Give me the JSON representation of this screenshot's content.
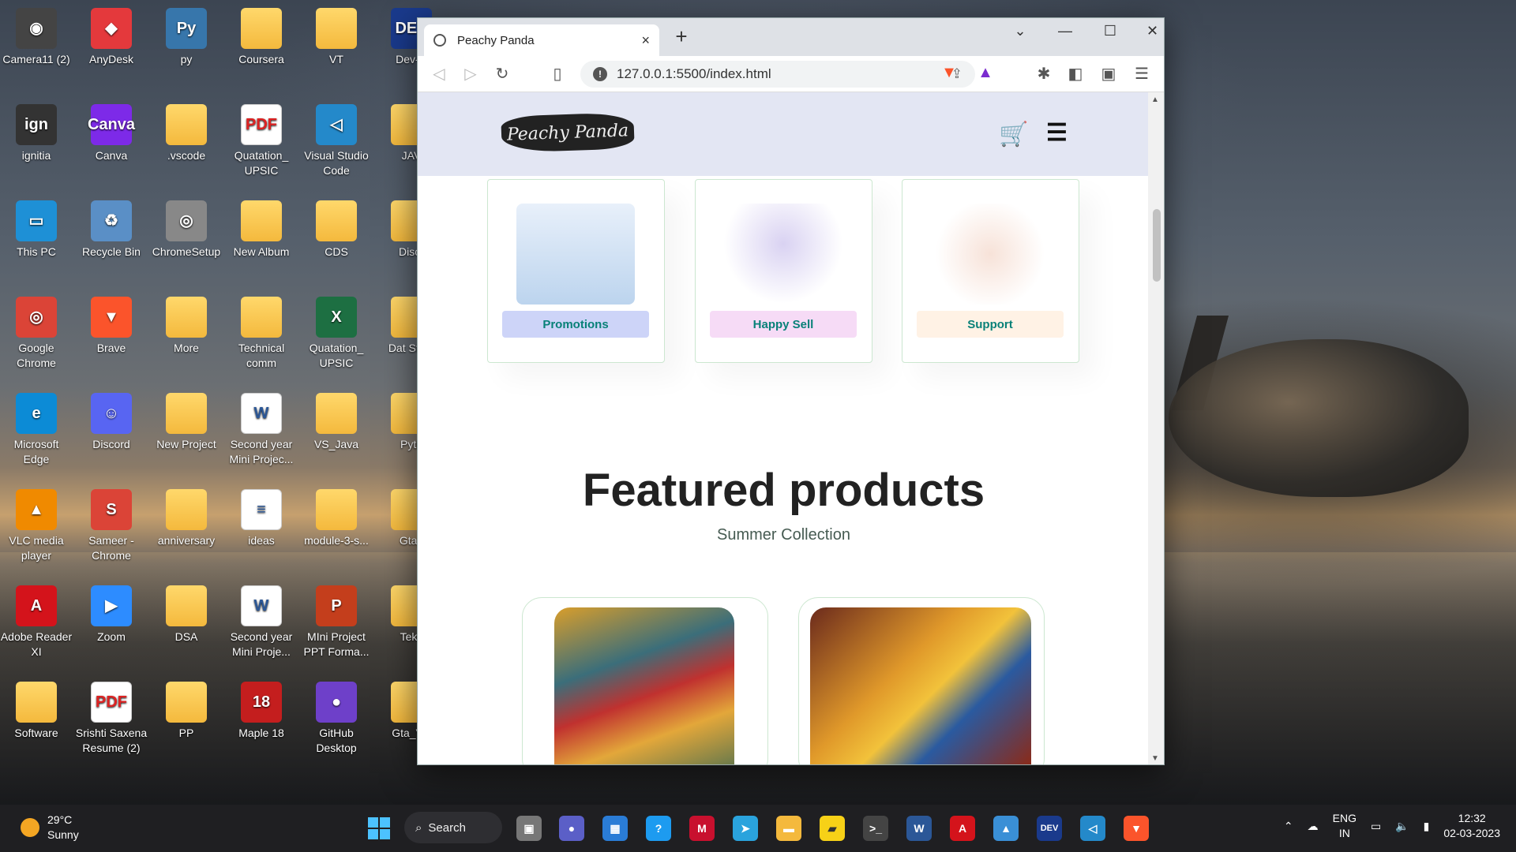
{
  "desktop_icons": [
    {
      "label": "Camera11 (2)",
      "glyph": "◉",
      "color": "#444"
    },
    {
      "label": "AnyDesk",
      "glyph": "◆",
      "color": "#e4393c"
    },
    {
      "label": "py",
      "glyph": "Py",
      "color": "#3776ab"
    },
    {
      "label": "Coursera",
      "glyph": "",
      "color": "folder"
    },
    {
      "label": "VT",
      "glyph": "",
      "color": "folder"
    },
    {
      "label": "Dev-C",
      "glyph": "DEV",
      "color": "#1a3a8c"
    },
    {
      "label": "ignitia",
      "glyph": "ign",
      "color": "#333"
    },
    {
      "label": "Canva",
      "glyph": "Canva",
      "color": "#7d2ae8"
    },
    {
      "label": ".vscode",
      "glyph": "",
      "color": "folder"
    },
    {
      "label": "Quatation_ UPSIC",
      "glyph": "PDF",
      "color": "pdf"
    },
    {
      "label": "Visual Studio Code",
      "glyph": "◁",
      "color": "#2489ca"
    },
    {
      "label": "JAV",
      "glyph": "",
      "color": "folder"
    },
    {
      "label": "This PC",
      "glyph": "▭",
      "color": "#1e90d6"
    },
    {
      "label": "Recycle Bin",
      "glyph": "♻",
      "color": "#5a8fc6"
    },
    {
      "label": "ChromeSetup",
      "glyph": "◎",
      "color": "#888"
    },
    {
      "label": "New Album",
      "glyph": "",
      "color": "folder"
    },
    {
      "label": "CDS",
      "glyph": "",
      "color": "folder"
    },
    {
      "label": "Discr",
      "glyph": "",
      "color": "folder"
    },
    {
      "label": "Google Chrome",
      "glyph": "◎",
      "color": "#db4437"
    },
    {
      "label": "Brave",
      "glyph": "▼",
      "color": "#fb542b"
    },
    {
      "label": "More",
      "glyph": "",
      "color": "folder"
    },
    {
      "label": "Technical comm",
      "glyph": "",
      "color": "folder"
    },
    {
      "label": "Quatation_ UPSIC",
      "glyph": "X",
      "color": "#1d6f42"
    },
    {
      "label": "Dat Struc",
      "glyph": "",
      "color": "folder"
    },
    {
      "label": "Microsoft Edge",
      "glyph": "e",
      "color": "#0c8bd6"
    },
    {
      "label": "Discord",
      "glyph": "☺",
      "color": "#5865f2"
    },
    {
      "label": "New Project",
      "glyph": "",
      "color": "folder"
    },
    {
      "label": "Second year Mini Projec...",
      "glyph": "W",
      "color": "word"
    },
    {
      "label": "VS_Java",
      "glyph": "",
      "color": "folder"
    },
    {
      "label": "Pyth",
      "glyph": "",
      "color": "folder"
    },
    {
      "label": "VLC media player",
      "glyph": "▲",
      "color": "#f08a00"
    },
    {
      "label": "Sameer - Chrome",
      "glyph": "S",
      "color": "#db4437"
    },
    {
      "label": "anniversary",
      "glyph": "",
      "color": "folder"
    },
    {
      "label": "ideas",
      "glyph": "≡",
      "color": "word"
    },
    {
      "label": "module-3-s...",
      "glyph": "",
      "color": "folder"
    },
    {
      "label": "Gta_",
      "glyph": "",
      "color": "folder"
    },
    {
      "label": "Adobe Reader XI",
      "glyph": "A",
      "color": "#d4131b"
    },
    {
      "label": "Zoom",
      "glyph": "▶",
      "color": "#2d8cff"
    },
    {
      "label": "DSA",
      "glyph": "",
      "color": "folder"
    },
    {
      "label": "Second year Mini Proje...",
      "glyph": "W",
      "color": "word"
    },
    {
      "label": "MIni Project PPT Forma...",
      "glyph": "P",
      "color": "#c43e1c"
    },
    {
      "label": "Tekk",
      "glyph": "",
      "color": "folder"
    },
    {
      "label": "Software",
      "glyph": "",
      "color": "folder"
    },
    {
      "label": "Srishti Saxena Resume  (2)",
      "glyph": "PDF",
      "color": "pdf"
    },
    {
      "label": "PP",
      "glyph": "",
      "color": "folder"
    },
    {
      "label": "Maple 18",
      "glyph": "18",
      "color": "#c41e1e"
    },
    {
      "label": "GitHub Desktop",
      "glyph": "●",
      "color": "#6e40c9"
    },
    {
      "label": "Gta_Vic",
      "glyph": "",
      "color": "folder"
    }
  ],
  "browser": {
    "tab_title": "Peachy Panda",
    "tab_close": "×",
    "new_tab": "+",
    "url": "127.0.0.1:5500/index.html",
    "window_controls": {
      "chevron": "⌄",
      "minimize": "—",
      "maximize": "☐",
      "close": "✕"
    }
  },
  "site": {
    "logo_text": "Peachy Panda",
    "features": [
      {
        "label": "Promotions",
        "bg": "#cdd4f8"
      },
      {
        "label": "Happy Sell",
        "bg": "#f6dbf6"
      },
      {
        "label": "Support",
        "bg": "#fff2e5"
      }
    ],
    "featured_title": "Featured products",
    "featured_subtitle": "Summer Collection"
  },
  "taskbar": {
    "temperature": "29°C",
    "weather": "Sunny",
    "search_label": "Search",
    "language_top": "ENG",
    "language_bottom": "IN",
    "time": "12:32",
    "date": "02-03-2023"
  }
}
